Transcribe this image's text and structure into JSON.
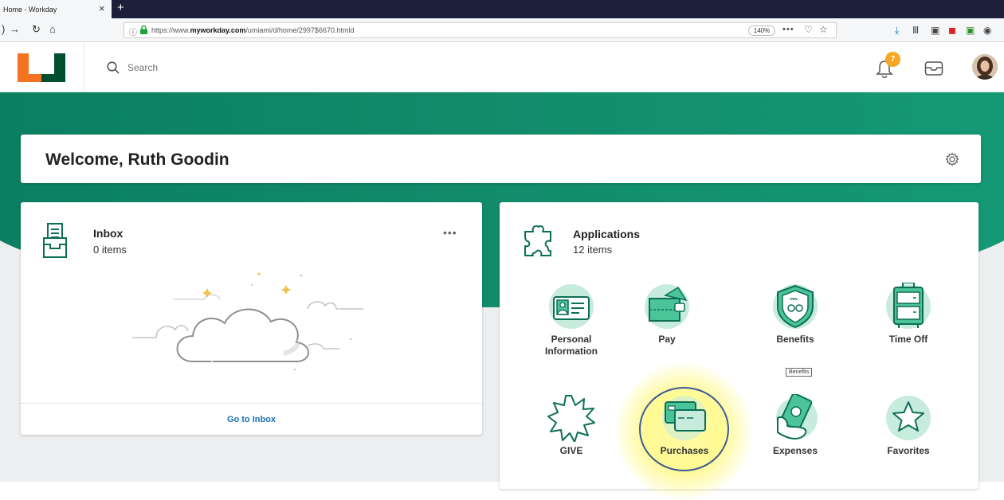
{
  "browser": {
    "tab_title": "Home - Workday",
    "tab_close": "×",
    "new_tab": "+",
    "url_prefix": "https://www.",
    "url_domain": "myworkday.com",
    "url_path": "/umiami/d/home/2997$6670.htmld",
    "zoom": "140%",
    "more": "•••"
  },
  "header": {
    "search_placeholder": "Search",
    "notification_count": "7"
  },
  "welcome": {
    "title": "Welcome, Ruth Goodin"
  },
  "inbox": {
    "title": "Inbox",
    "count": "0 items",
    "more": "•••",
    "link": "Go to Inbox"
  },
  "applications": {
    "title": "Applications",
    "count": "12 items",
    "items": [
      {
        "label": "Personal Information",
        "icon": "personal-information-icon"
      },
      {
        "label": "Pay",
        "icon": "wallet-icon"
      },
      {
        "label": "Benefits",
        "icon": "shield-icon"
      },
      {
        "label": "Time Off",
        "icon": "suitcase-icon"
      },
      {
        "label": "GIVE",
        "icon": "starburst-icon"
      },
      {
        "label": "Purchases",
        "icon": "credit-card-icon"
      },
      {
        "label": "Expenses",
        "icon": "money-hand-icon"
      },
      {
        "label": "Favorites",
        "icon": "star-icon"
      }
    ]
  },
  "tooltip": "Benefits",
  "colors": {
    "brand_green": "#0a7e62",
    "logo_orange": "#f47321",
    "logo_green": "#005030",
    "link_blue": "#1d6fb8",
    "badge_orange": "#f5a623"
  }
}
